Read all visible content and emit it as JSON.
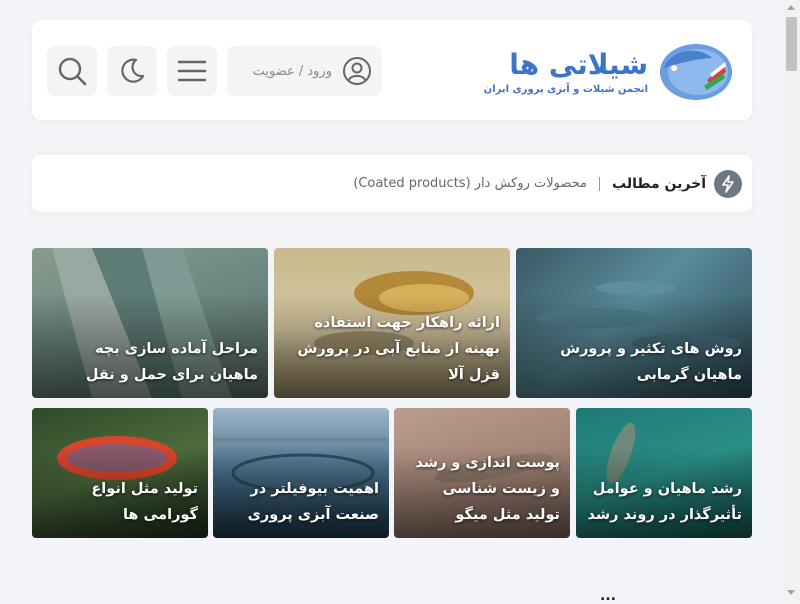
{
  "header": {
    "logo_title": "شیلاتی ها",
    "logo_subtitle": "انجمن شیلات و آبزی پروری ایران",
    "login_label": "ورود / عضویت",
    "icons": [
      "search-icon",
      "moon-icon",
      "menu-icon",
      "user-icon",
      "fish-logo-icon"
    ]
  },
  "news": {
    "label": "آخرین مطالب",
    "item": "محصولات روکش دار (Coated products)",
    "icon": "lightning-icon"
  },
  "featured": [
    {
      "title": "روش های تکثیر و پرورش ماهیان گرمابی"
    },
    {
      "title": "ارائه راهکار جهت استفاده بهینه از منابع آبی در پرورش قزل آلا"
    },
    {
      "title": "مراحل آماده سازی بچه ماهیان برای حمل و نقل"
    },
    {
      "title": "رشد ماهیان و عوامل تأثیرگذار در روند رشد"
    },
    {
      "title": "پوست اندازی و رشد و زیست شناسی تولید مثل میگو"
    },
    {
      "title": "اهمیت بیوفیلتر در صنعت آبزی پروری"
    },
    {
      "title": "تولید مثل انواع گورامی ها"
    }
  ],
  "bottom_heading": "..."
}
